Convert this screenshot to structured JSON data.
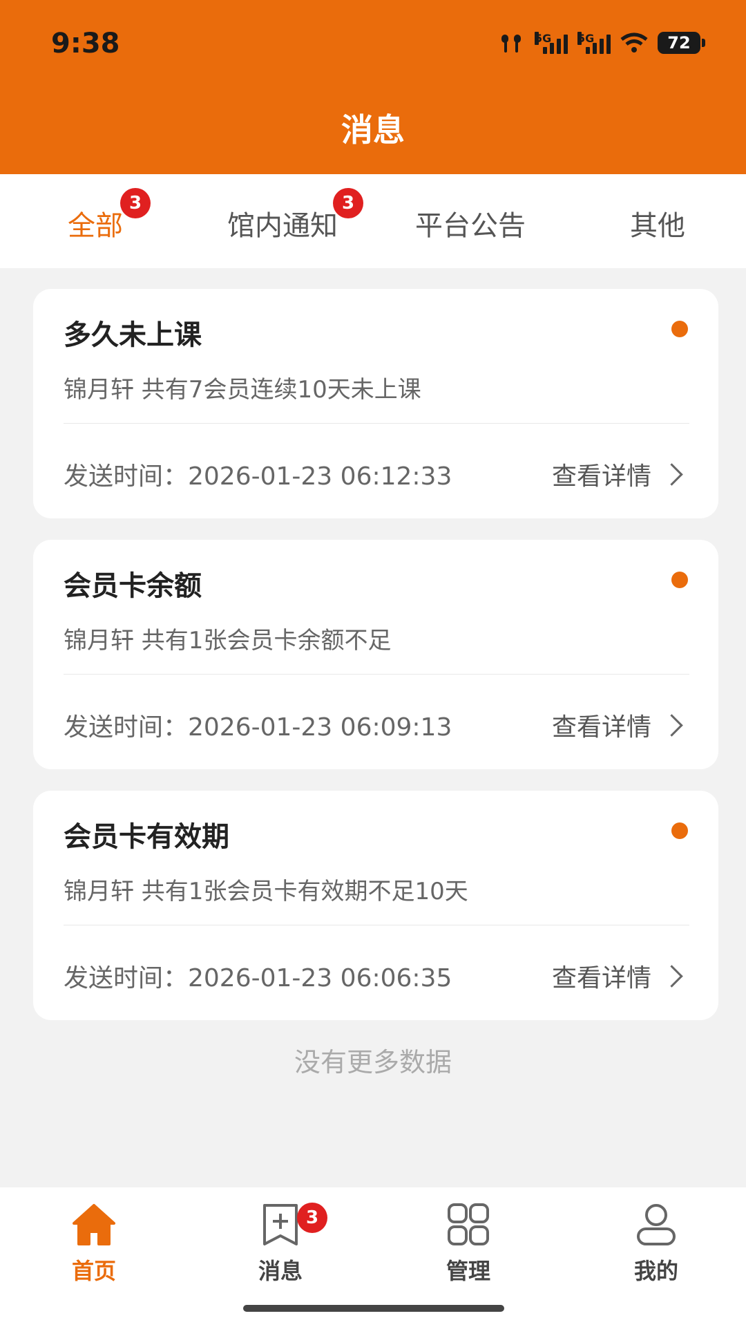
{
  "status_bar": {
    "time": "9:38",
    "network1": "5G",
    "network2": "5G",
    "battery": "72"
  },
  "header": {
    "title": "消息"
  },
  "tabs": [
    {
      "label": "全部",
      "badge": "3",
      "active": true
    },
    {
      "label": "馆内通知",
      "badge": "3",
      "active": false
    },
    {
      "label": "平台公告",
      "badge": "",
      "active": false
    },
    {
      "label": "其他",
      "badge": "",
      "active": false
    }
  ],
  "messages": [
    {
      "title": "多久未上课",
      "description": "锦月轩 共有7会员连续10天未上课",
      "time": "发送时间：2026-01-23 06:12:33",
      "link": "查看详情",
      "unread": true
    },
    {
      "title": "会员卡余额",
      "description": "锦月轩 共有1张会员卡余额不足",
      "time": "发送时间：2026-01-23 06:09:13",
      "link": "查看详情",
      "unread": true
    },
    {
      "title": "会员卡有效期",
      "description": "锦月轩 共有1张会员卡有效期不足10天",
      "time": "发送时间：2026-01-23 06:06:35",
      "link": "查看详情",
      "unread": true
    }
  ],
  "footer_text": "没有更多数据",
  "bottom_nav": [
    {
      "label": "首页",
      "icon": "home-icon",
      "active": true,
      "badge": ""
    },
    {
      "label": "消息",
      "icon": "message-icon",
      "active": false,
      "badge": "3"
    },
    {
      "label": "管理",
      "icon": "grid-icon",
      "active": false,
      "badge": ""
    },
    {
      "label": "我的",
      "icon": "user-icon",
      "active": false,
      "badge": ""
    }
  ],
  "colors": {
    "accent": "#ea6c0c",
    "badge": "#e02020"
  }
}
